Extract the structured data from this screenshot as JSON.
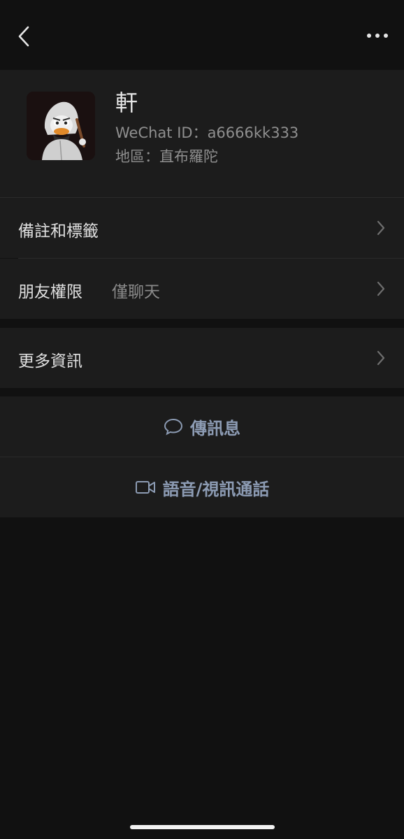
{
  "nav": {
    "back_icon": "chevron-left-icon",
    "more_icon": "ellipsis-icon"
  },
  "profile": {
    "name": "軒",
    "wechat_id": "WeChat ID：a6666kk333",
    "region": "地區：直布羅陀"
  },
  "cells": {
    "notes_tags": {
      "label": "備註和標籤"
    },
    "friend_permissions": {
      "label": "朋友權限",
      "value": "僅聊天"
    },
    "more_info": {
      "label": "更多資訊"
    }
  },
  "actions": {
    "send_message": {
      "label": "傳訊息",
      "icon": "chat-bubble-icon"
    },
    "voice_video_call": {
      "label": "語音/視訊通話",
      "icon": "video-camera-icon"
    }
  },
  "colors": {
    "background": "#111111",
    "surface": "#1c1c1c",
    "accent_text": "#8c9bb3"
  }
}
